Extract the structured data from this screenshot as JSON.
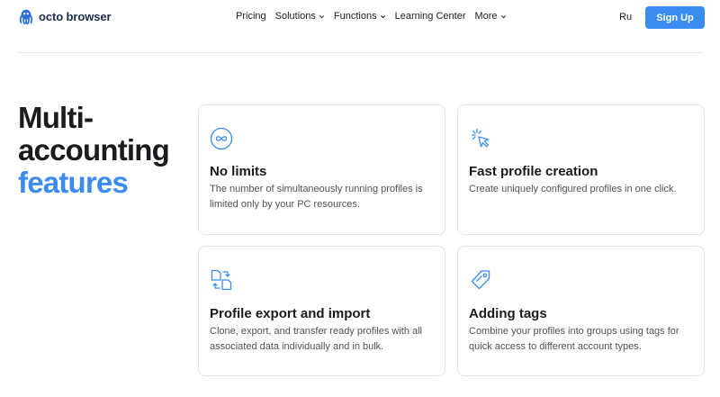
{
  "header": {
    "logo_text": "octo browser",
    "logo_icon": "octopus-icon",
    "nav": [
      {
        "label": "Pricing",
        "has_dropdown": false
      },
      {
        "label": "Solutions",
        "has_dropdown": true
      },
      {
        "label": "Functions",
        "has_dropdown": true
      },
      {
        "label": "Learning Center",
        "has_dropdown": false
      },
      {
        "label": "More",
        "has_dropdown": true
      }
    ],
    "language": "Ru",
    "signup_label": "Sign Up"
  },
  "hero": {
    "line1": "Multi-",
    "line2": "accounting",
    "line3": "features"
  },
  "features": [
    {
      "icon": "infinity-icon",
      "title": "No limits",
      "description": "The number of simultaneously running profiles is limited only by your PC resources."
    },
    {
      "icon": "click-sparkle-icon",
      "title": "Fast profile creation",
      "description": "Create uniquely configured profiles in one click."
    },
    {
      "icon": "file-transfer-icon",
      "title": "Profile export and import",
      "description": "Clone, export, and transfer ready profiles with all associated data individually and in bulk."
    },
    {
      "icon": "tag-icon",
      "title": "Adding tags",
      "description": "Combine your profiles into groups using tags for quick access to different account types."
    }
  ],
  "colors": {
    "accent": "#3b8cf0",
    "text": "#1b1b1f",
    "muted": "#505057",
    "border": "#e4e4e8"
  }
}
